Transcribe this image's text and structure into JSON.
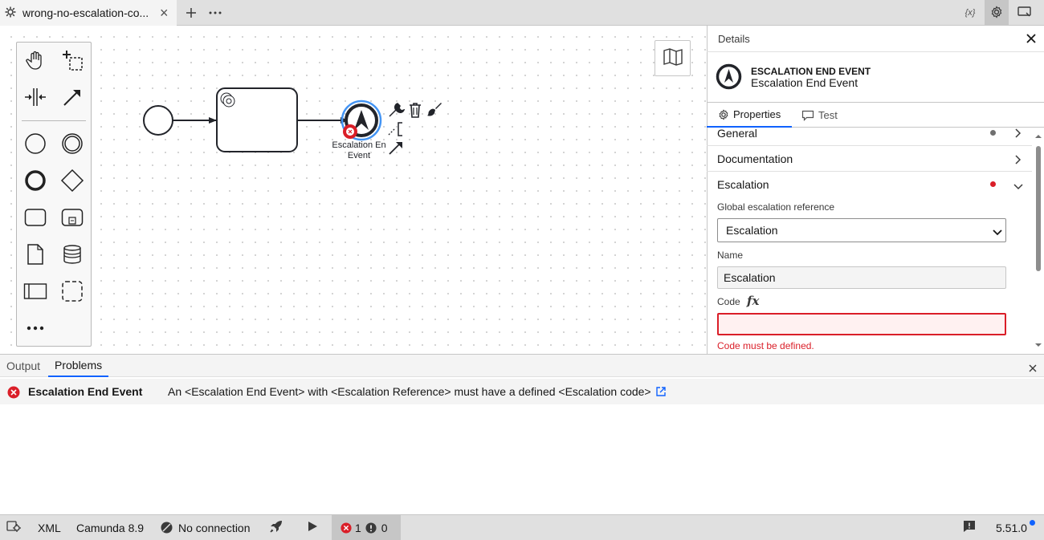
{
  "tab": {
    "title": "wrong-no-escalation-co...",
    "close": "×"
  },
  "toolbar": {
    "variables_label": "{x}"
  },
  "canvas": {
    "event_label_line1": "Escalation En",
    "event_label_line2": "Event"
  },
  "details": {
    "header": "Details",
    "element_type": "ESCALATION END EVENT",
    "element_name": "Escalation End Event",
    "tabs": [
      "Properties",
      "Test"
    ],
    "groups": {
      "general": "General",
      "documentation": "Documentation",
      "escalation": "Escalation"
    },
    "escalation": {
      "ref_label": "Global escalation reference",
      "ref_value": "Escalation",
      "name_label": "Name",
      "name_value": "Escalation",
      "code_label": "Code",
      "code_fx": "fx",
      "code_value": "",
      "code_error": "Code must be defined."
    }
  },
  "bottom": {
    "tabs": [
      "Output",
      "Problems"
    ],
    "problem": {
      "element": "Escalation End Event",
      "message": "An <Escalation End Event> with <Escalation Reference> must have a defined <Escalation code>"
    }
  },
  "status": {
    "xml": "XML",
    "engine": "Camunda 8.9",
    "connection": "No connection",
    "errors": "1",
    "warnings": "0",
    "version": "5.51.0"
  },
  "colors": {
    "accent": "#0f62fe",
    "error": "#da1e28",
    "selection": "#4394f4"
  }
}
